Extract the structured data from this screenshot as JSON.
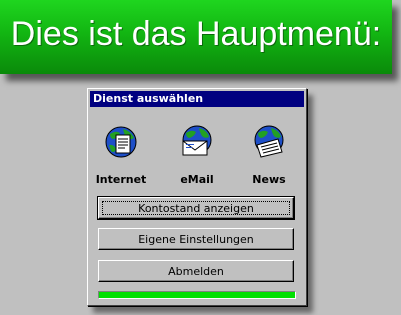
{
  "banner": {
    "title": "Dies ist das Hauptmenü:"
  },
  "dialog": {
    "title": "Dienst auswählen",
    "services": [
      {
        "label": "Internet",
        "icon": "globe-document-icon"
      },
      {
        "label": "eMail",
        "icon": "globe-envelope-icon"
      },
      {
        "label": "News",
        "icon": "globe-newspaper-icon"
      }
    ],
    "buttons": {
      "balance": "Kontostand anzeigen",
      "settings": "Eigene Einstellungen",
      "logout": "Abmelden"
    },
    "progress": 1.0
  },
  "colors": {
    "banner_green": "#12b512",
    "titlebar": "#000080",
    "progress": "#00e000",
    "window": "#c0c0c0"
  }
}
